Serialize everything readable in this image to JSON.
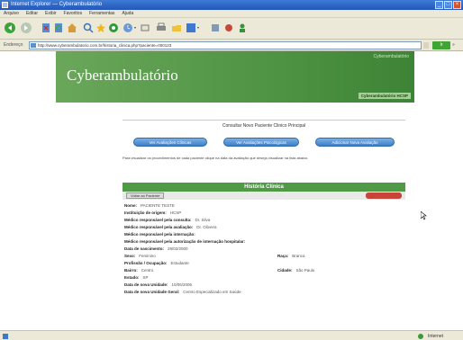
{
  "window": {
    "title": "Internet Explorer — Cyberambulatório",
    "controls": [
      "minimize",
      "maximize",
      "close"
    ]
  },
  "menu": [
    "Arquivo",
    "Editar",
    "Exibir",
    "Favoritos",
    "Ferramentas",
    "Ajuda"
  ],
  "address": {
    "label": "Endereço",
    "url": "http://www.cyberambulatorio.com.br/historia_clinica.php?paciente=000123",
    "go_label": "Ir",
    "links_label": "»"
  },
  "banner": {
    "title": "Cyberambulatório",
    "top_right": "Cyberambulatório",
    "bottom_right": "Cyberambulatório HCSP"
  },
  "page": {
    "consult_text": "Consultar Novo Paciente Clinico Principal",
    "nav_buttons": [
      "Ver Avaliações Clínicas",
      "Ver Avaliações Psicológicas",
      "Adicionar Nova Avaliação"
    ],
    "note": "Para visualizar os procedimentos de cada paciente clique na data da avaliação que deseja visualizar na lista abaixo.",
    "history_title": "História Clínica",
    "sub_left_btn": "Voltar ao Paciente",
    "fields": [
      {
        "label": "Nome:",
        "value": "PACIENTE TESTE"
      },
      {
        "label": "Instituição de origem:",
        "value": "HCSP"
      },
      {
        "label": "Médico responsável pela consulta:",
        "value": "Dr. Silva"
      },
      {
        "label": "Médico responsável pela avaliação:",
        "value": "Dr. Oliveira"
      },
      {
        "label": "Médico responsável pela internação:",
        "value": ""
      },
      {
        "label": "Médico responsável pela autorização de internação hospitalar:",
        "value": ""
      },
      {
        "label": "Data de nascimento:",
        "value": "29/02/2000"
      },
      {
        "label": "Sexo:",
        "value": "Feminino",
        "label2": "Raça:",
        "value2": "Branca"
      },
      {
        "label": "Profissão / Ocupação:",
        "value": "Estudante"
      },
      {
        "label": "Bairro:",
        "value": "Centro",
        "label2": "Cidade:",
        "value2": "São Paulo"
      },
      {
        "label": "Estado:",
        "value": "SP"
      },
      {
        "label": "Data de nova Unidade:",
        "value": "10/06/2006"
      },
      {
        "label": "Data de nova Unidade Geral:",
        "value": "Centro Especializado em Saúde"
      }
    ]
  },
  "status": {
    "zone": "Internet"
  },
  "colors": {
    "banner_green": "#4f9344",
    "history_bar": "#4f9947",
    "nav_button_blue": "#3f7fc7",
    "titlebar_blue": "#2456b8"
  }
}
